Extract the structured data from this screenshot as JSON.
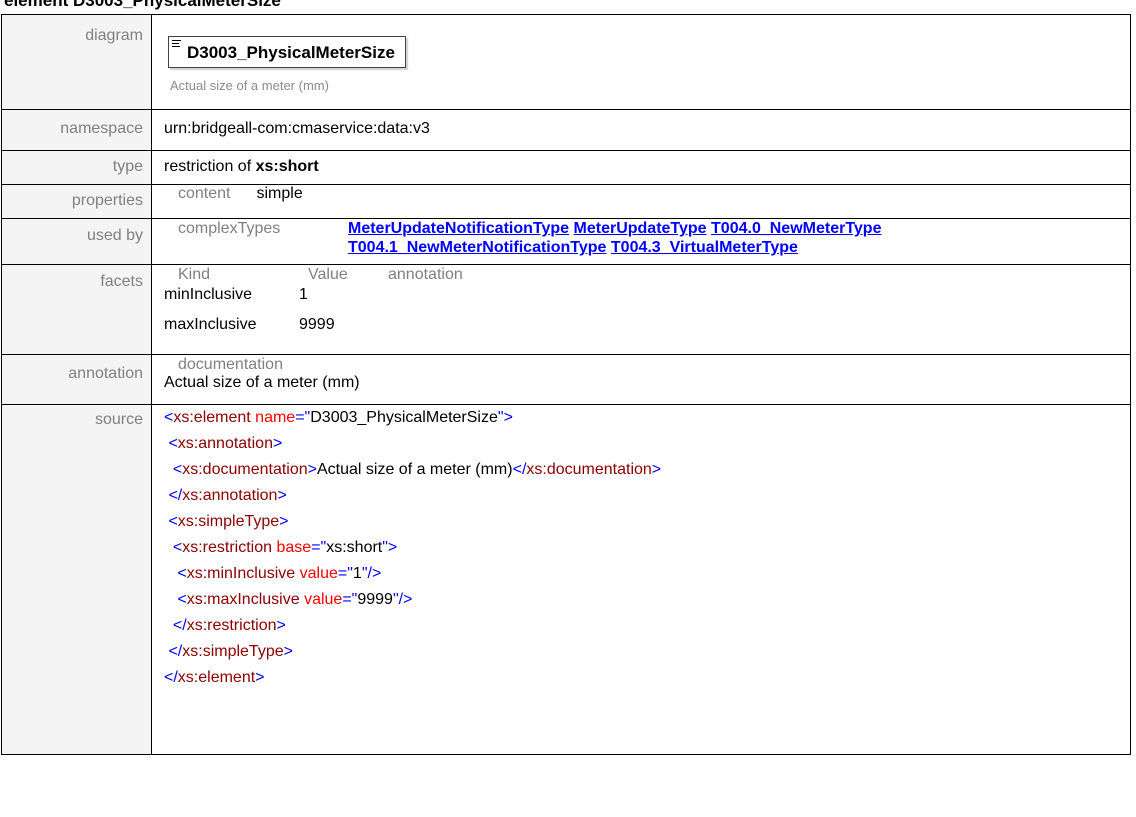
{
  "title": "element D3003_PhysicalMeterSize",
  "labels": {
    "diagram": "diagram",
    "namespace": "namespace",
    "type": "type",
    "properties": "properties",
    "used_by": "used by",
    "facets": "facets",
    "annotation": "annotation",
    "source": "source"
  },
  "diagram": {
    "name": "D3003_PhysicalMeterSize",
    "doc": "Actual size of a meter (mm)"
  },
  "namespace": "urn:bridgeall-com:cmaservice:data:v3",
  "type": {
    "prefix": "restriction of ",
    "base": "xs:short"
  },
  "properties": {
    "key": "content",
    "value": "simple"
  },
  "used_by": {
    "kind": "complexTypes",
    "links": [
      "MeterUpdateNotificationType",
      "MeterUpdateType",
      "T004.0_NewMeterType",
      "T004.1_NewMeterNotificationType",
      "T004.3_VirtualMeterType"
    ]
  },
  "facets": {
    "headers": [
      "Kind",
      "Value",
      "annotation"
    ],
    "rows": [
      {
        "kind": "minInclusive",
        "value": "1"
      },
      {
        "kind": "maxInclusive",
        "value": "9999"
      }
    ]
  },
  "annotation": {
    "header": "documentation",
    "text": "Actual size of a meter (mm)"
  },
  "source": {
    "element": "xs:element",
    "name_attr": "name",
    "name_val": "D3003_PhysicalMeterSize",
    "annotation_tag": "xs:annotation",
    "documentation_tag": "xs:documentation",
    "doc_text": "Actual size of a meter (mm)",
    "simpletype_tag": "xs:simpleType",
    "restriction_tag": "xs:restriction",
    "base_attr": "base",
    "base_val": "xs:short",
    "min_tag": "xs:minInclusive",
    "max_tag": "xs:maxInclusive",
    "value_attr": "value",
    "min_val": "1",
    "max_val": "9999"
  }
}
